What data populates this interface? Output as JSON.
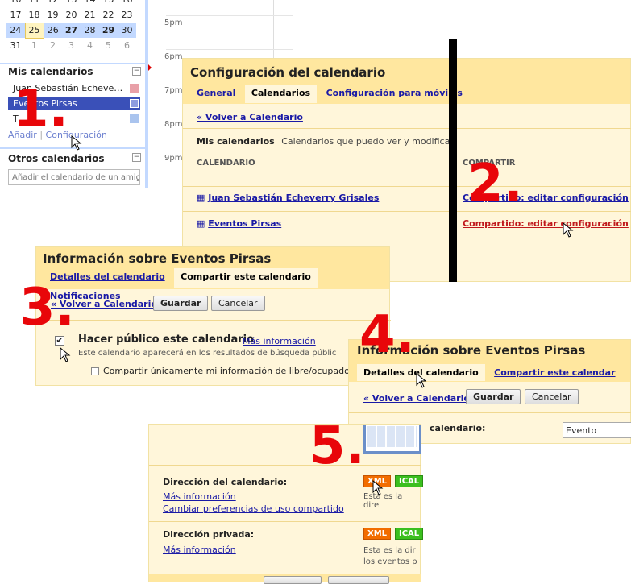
{
  "mini_calendar": {
    "rows": [
      [
        "10",
        "11",
        "12",
        "13",
        "14",
        "15",
        "16"
      ],
      [
        "17",
        "18",
        "19",
        "20",
        "21",
        "22",
        "23"
      ],
      [
        "24",
        "25",
        "26",
        "27",
        "28",
        "29",
        "30"
      ],
      [
        "31",
        "1",
        "2",
        "3",
        "4",
        "5",
        "6"
      ]
    ]
  },
  "my_calendars": {
    "title": "Mis calendarios",
    "items": [
      "Juan Sebastián Echeve…",
      "Eventos Pirsas",
      "T"
    ],
    "add_link": "Añadir",
    "settings_link": "Configuración"
  },
  "other_calendars": {
    "title": "Otros calendarios",
    "placeholder": "Añadir el calendario de un amigo"
  },
  "times": [
    "5pm",
    "6pm",
    "7pm",
    "8pm",
    "9pm"
  ],
  "steps": [
    "1.",
    "2.",
    "3.",
    "4.",
    "5."
  ],
  "settings_panel": {
    "title": "Configuración del calendario",
    "tabs": [
      "General",
      "Calendarios",
      "Configuración para móviles"
    ],
    "back_link": "« Volver a Calendario",
    "my_cal_label": "Mis calendarios",
    "my_cal_desc": "Calendarios que puedo ver y modificar",
    "col_calendar": "CALENDARIO",
    "col_share": "COMPARTIR",
    "rows": [
      {
        "name": "Juan Sebastián Echeverry Grisales",
        "share": "Compartido: editar configuración"
      },
      {
        "name": "Eventos Pirsas",
        "share": "Compartido: editar configuración"
      }
    ]
  },
  "share_panel": {
    "title": "Información sobre Eventos Pirsas",
    "tabs": [
      "Detalles del calendario",
      "Compartir este calendario",
      "Notificaciones"
    ],
    "back_link": "« Volver a Calendario",
    "save": "Guardar",
    "cancel": "Cancelar",
    "public_label": "Hacer público este calendario",
    "more_info": "Más información",
    "public_desc": "Este calendario aparecerá en los resultados de búsqueda públic",
    "freebusy_label": "Compartir únicamente mi información de libre/ocupado (o"
  },
  "details_panel": {
    "title": "Información sobre Eventos Pirsas",
    "tabs": [
      "Detalles del calendario",
      "Compartir este calendar"
    ],
    "back_link": "« Volver a Calendario",
    "save": "Guardar",
    "cancel": "Cancelar",
    "name_label": "calendario:",
    "name_value": "Evento"
  },
  "address_panel": {
    "cal_address_label": "Dirección del calendario:",
    "more_info": "Más información",
    "change_sharing": "Cambiar preferencias de uso compartido",
    "private_label": "Dirección privada:",
    "private_more": "Más información",
    "xml": "XML",
    "ical": "ICAL",
    "desc1": "Esta es la dire",
    "desc2": "Esta es la dir",
    "desc3": "los eventos p"
  },
  "colors": {
    "accent_red": "#e8060a",
    "panel_bg": "#fff6da",
    "header_bg": "#ffe79f",
    "selected": "#3a50b8"
  }
}
